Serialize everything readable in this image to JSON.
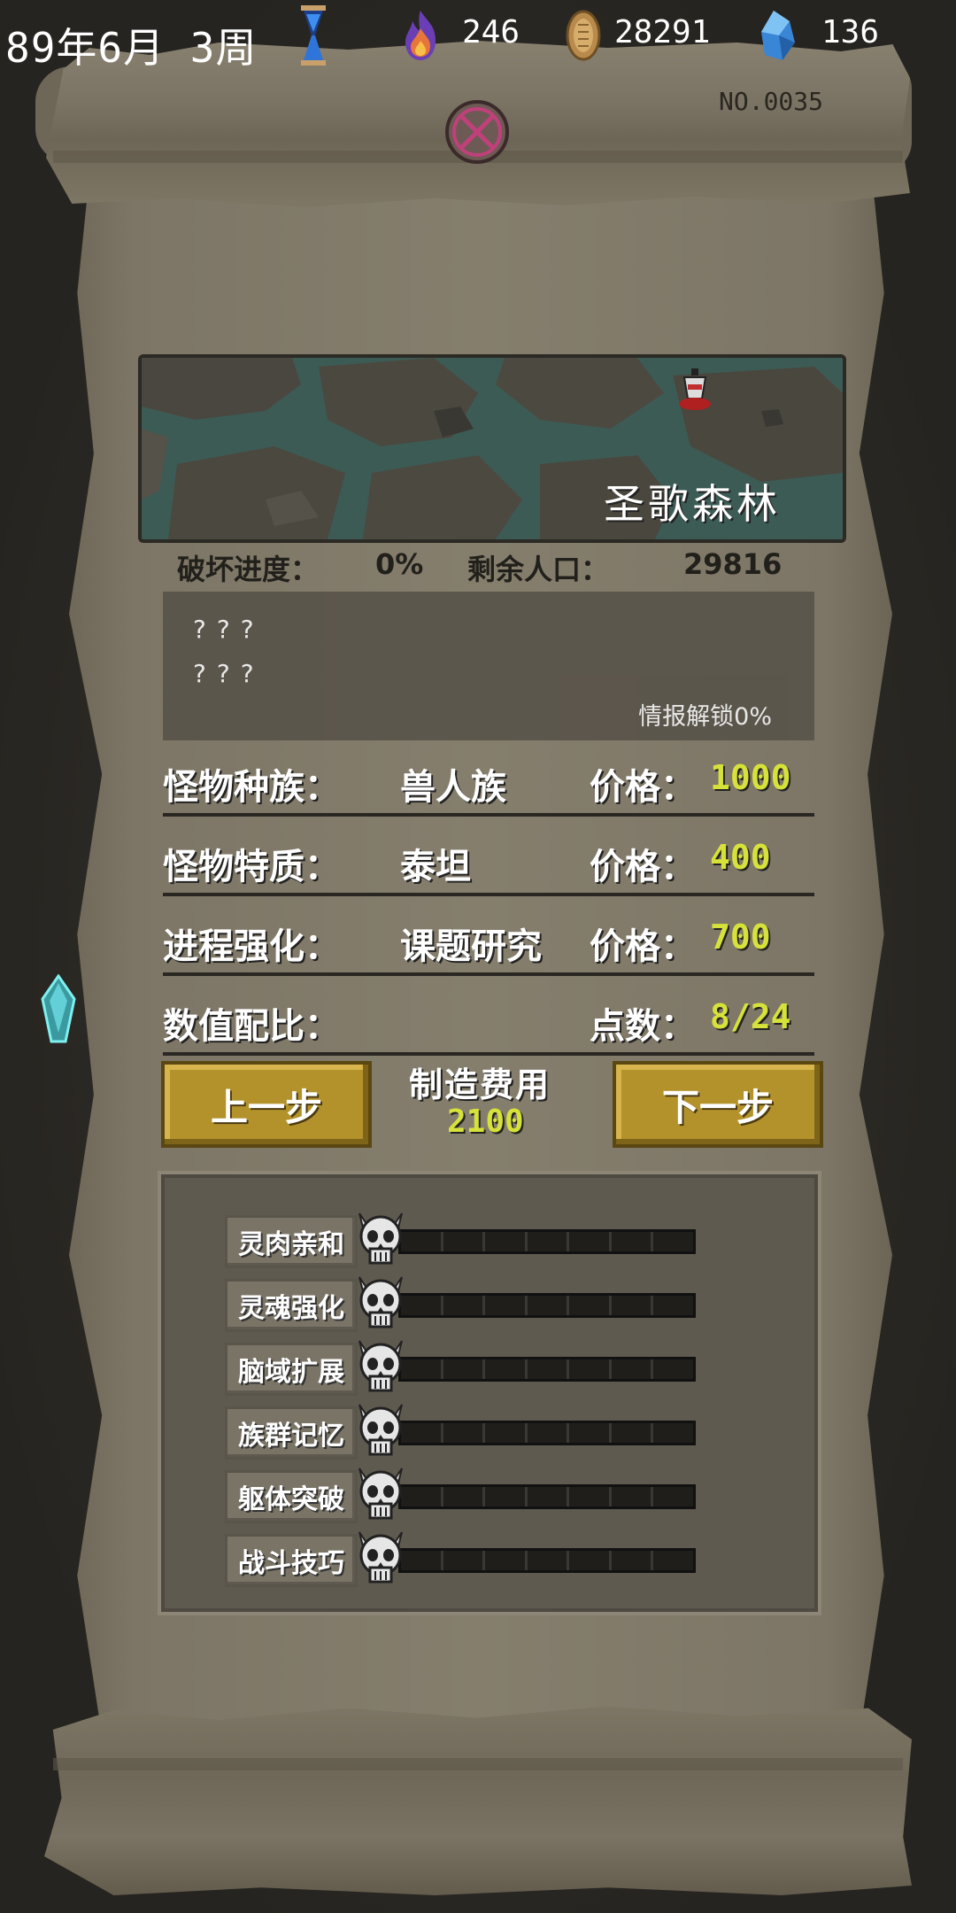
{
  "topbar": {
    "date": "89年6月 3周",
    "resources": [
      {
        "icon": "flame-icon",
        "value": "246",
        "color": "#8a5acd"
      },
      {
        "icon": "coin-icon",
        "value": "28291",
        "color": "#c89a5a"
      },
      {
        "icon": "crystal-icon",
        "value": "136",
        "color": "#4aa0e0"
      }
    ]
  },
  "scroll": {
    "number": "NO.0035"
  },
  "map": {
    "name": "圣歌森林"
  },
  "stats": {
    "destroy_label": "破坏进度：",
    "destroy_value": "0%",
    "population_label": "剩余人口：",
    "population_value": "29816"
  },
  "intel": {
    "line1": "???",
    "line2": "???",
    "unlock": "情报解锁0%"
  },
  "rows": [
    {
      "label": "怪物种族：",
      "value": "兽人族",
      "price_label": "价格：",
      "price": "1000"
    },
    {
      "label": "怪物特质：",
      "value": "泰坦",
      "price_label": "价格：",
      "price": "400"
    },
    {
      "label": "进程强化：",
      "value": "课题研究",
      "price_label": "价格：",
      "price": "700"
    },
    {
      "label": "数值配比：",
      "value": "",
      "price_label": "点数：",
      "price": "8/24"
    }
  ],
  "actions": {
    "prev": "上一步",
    "next": "下一步",
    "cost_title": "制造费用",
    "cost_value": "2100"
  },
  "attributes": [
    {
      "label": "灵肉亲和",
      "level": 0,
      "max": 7
    },
    {
      "label": "灵魂强化",
      "level": 0,
      "max": 7
    },
    {
      "label": "脑域扩展",
      "level": 0,
      "max": 7
    },
    {
      "label": "族群记忆",
      "level": 0,
      "max": 7
    },
    {
      "label": "躯体突破",
      "level": 0,
      "max": 7
    },
    {
      "label": "战斗技巧",
      "level": 0,
      "max": 7
    }
  ]
}
